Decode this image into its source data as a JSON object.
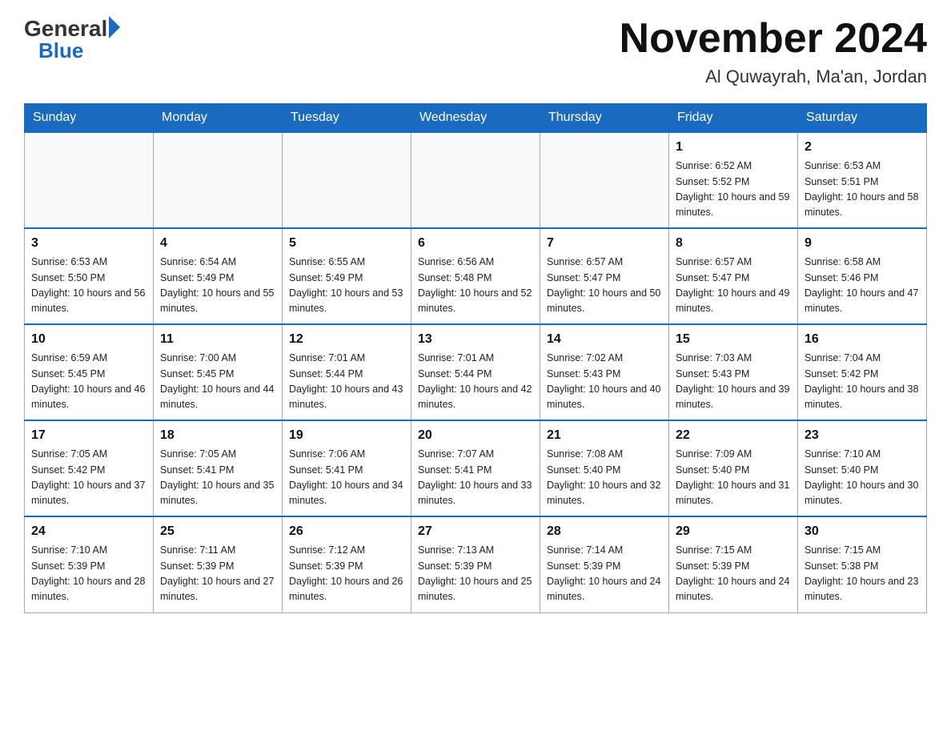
{
  "header": {
    "logo_general": "General",
    "logo_blue": "Blue",
    "month_title": "November 2024",
    "location": "Al Quwayrah, Ma'an, Jordan"
  },
  "weekdays": [
    "Sunday",
    "Monday",
    "Tuesday",
    "Wednesday",
    "Thursday",
    "Friday",
    "Saturday"
  ],
  "weeks": [
    [
      {
        "day": "",
        "sunrise": "",
        "sunset": "",
        "daylight": ""
      },
      {
        "day": "",
        "sunrise": "",
        "sunset": "",
        "daylight": ""
      },
      {
        "day": "",
        "sunrise": "",
        "sunset": "",
        "daylight": ""
      },
      {
        "day": "",
        "sunrise": "",
        "sunset": "",
        "daylight": ""
      },
      {
        "day": "",
        "sunrise": "",
        "sunset": "",
        "daylight": ""
      },
      {
        "day": "1",
        "sunrise": "Sunrise: 6:52 AM",
        "sunset": "Sunset: 5:52 PM",
        "daylight": "Daylight: 10 hours and 59 minutes."
      },
      {
        "day": "2",
        "sunrise": "Sunrise: 6:53 AM",
        "sunset": "Sunset: 5:51 PM",
        "daylight": "Daylight: 10 hours and 58 minutes."
      }
    ],
    [
      {
        "day": "3",
        "sunrise": "Sunrise: 6:53 AM",
        "sunset": "Sunset: 5:50 PM",
        "daylight": "Daylight: 10 hours and 56 minutes."
      },
      {
        "day": "4",
        "sunrise": "Sunrise: 6:54 AM",
        "sunset": "Sunset: 5:49 PM",
        "daylight": "Daylight: 10 hours and 55 minutes."
      },
      {
        "day": "5",
        "sunrise": "Sunrise: 6:55 AM",
        "sunset": "Sunset: 5:49 PM",
        "daylight": "Daylight: 10 hours and 53 minutes."
      },
      {
        "day": "6",
        "sunrise": "Sunrise: 6:56 AM",
        "sunset": "Sunset: 5:48 PM",
        "daylight": "Daylight: 10 hours and 52 minutes."
      },
      {
        "day": "7",
        "sunrise": "Sunrise: 6:57 AM",
        "sunset": "Sunset: 5:47 PM",
        "daylight": "Daylight: 10 hours and 50 minutes."
      },
      {
        "day": "8",
        "sunrise": "Sunrise: 6:57 AM",
        "sunset": "Sunset: 5:47 PM",
        "daylight": "Daylight: 10 hours and 49 minutes."
      },
      {
        "day": "9",
        "sunrise": "Sunrise: 6:58 AM",
        "sunset": "Sunset: 5:46 PM",
        "daylight": "Daylight: 10 hours and 47 minutes."
      }
    ],
    [
      {
        "day": "10",
        "sunrise": "Sunrise: 6:59 AM",
        "sunset": "Sunset: 5:45 PM",
        "daylight": "Daylight: 10 hours and 46 minutes."
      },
      {
        "day": "11",
        "sunrise": "Sunrise: 7:00 AM",
        "sunset": "Sunset: 5:45 PM",
        "daylight": "Daylight: 10 hours and 44 minutes."
      },
      {
        "day": "12",
        "sunrise": "Sunrise: 7:01 AM",
        "sunset": "Sunset: 5:44 PM",
        "daylight": "Daylight: 10 hours and 43 minutes."
      },
      {
        "day": "13",
        "sunrise": "Sunrise: 7:01 AM",
        "sunset": "Sunset: 5:44 PM",
        "daylight": "Daylight: 10 hours and 42 minutes."
      },
      {
        "day": "14",
        "sunrise": "Sunrise: 7:02 AM",
        "sunset": "Sunset: 5:43 PM",
        "daylight": "Daylight: 10 hours and 40 minutes."
      },
      {
        "day": "15",
        "sunrise": "Sunrise: 7:03 AM",
        "sunset": "Sunset: 5:43 PM",
        "daylight": "Daylight: 10 hours and 39 minutes."
      },
      {
        "day": "16",
        "sunrise": "Sunrise: 7:04 AM",
        "sunset": "Sunset: 5:42 PM",
        "daylight": "Daylight: 10 hours and 38 minutes."
      }
    ],
    [
      {
        "day": "17",
        "sunrise": "Sunrise: 7:05 AM",
        "sunset": "Sunset: 5:42 PM",
        "daylight": "Daylight: 10 hours and 37 minutes."
      },
      {
        "day": "18",
        "sunrise": "Sunrise: 7:05 AM",
        "sunset": "Sunset: 5:41 PM",
        "daylight": "Daylight: 10 hours and 35 minutes."
      },
      {
        "day": "19",
        "sunrise": "Sunrise: 7:06 AM",
        "sunset": "Sunset: 5:41 PM",
        "daylight": "Daylight: 10 hours and 34 minutes."
      },
      {
        "day": "20",
        "sunrise": "Sunrise: 7:07 AM",
        "sunset": "Sunset: 5:41 PM",
        "daylight": "Daylight: 10 hours and 33 minutes."
      },
      {
        "day": "21",
        "sunrise": "Sunrise: 7:08 AM",
        "sunset": "Sunset: 5:40 PM",
        "daylight": "Daylight: 10 hours and 32 minutes."
      },
      {
        "day": "22",
        "sunrise": "Sunrise: 7:09 AM",
        "sunset": "Sunset: 5:40 PM",
        "daylight": "Daylight: 10 hours and 31 minutes."
      },
      {
        "day": "23",
        "sunrise": "Sunrise: 7:10 AM",
        "sunset": "Sunset: 5:40 PM",
        "daylight": "Daylight: 10 hours and 30 minutes."
      }
    ],
    [
      {
        "day": "24",
        "sunrise": "Sunrise: 7:10 AM",
        "sunset": "Sunset: 5:39 PM",
        "daylight": "Daylight: 10 hours and 28 minutes."
      },
      {
        "day": "25",
        "sunrise": "Sunrise: 7:11 AM",
        "sunset": "Sunset: 5:39 PM",
        "daylight": "Daylight: 10 hours and 27 minutes."
      },
      {
        "day": "26",
        "sunrise": "Sunrise: 7:12 AM",
        "sunset": "Sunset: 5:39 PM",
        "daylight": "Daylight: 10 hours and 26 minutes."
      },
      {
        "day": "27",
        "sunrise": "Sunrise: 7:13 AM",
        "sunset": "Sunset: 5:39 PM",
        "daylight": "Daylight: 10 hours and 25 minutes."
      },
      {
        "day": "28",
        "sunrise": "Sunrise: 7:14 AM",
        "sunset": "Sunset: 5:39 PM",
        "daylight": "Daylight: 10 hours and 24 minutes."
      },
      {
        "day": "29",
        "sunrise": "Sunrise: 7:15 AM",
        "sunset": "Sunset: 5:39 PM",
        "daylight": "Daylight: 10 hours and 24 minutes."
      },
      {
        "day": "30",
        "sunrise": "Sunrise: 7:15 AM",
        "sunset": "Sunset: 5:38 PM",
        "daylight": "Daylight: 10 hours and 23 minutes."
      }
    ]
  ]
}
